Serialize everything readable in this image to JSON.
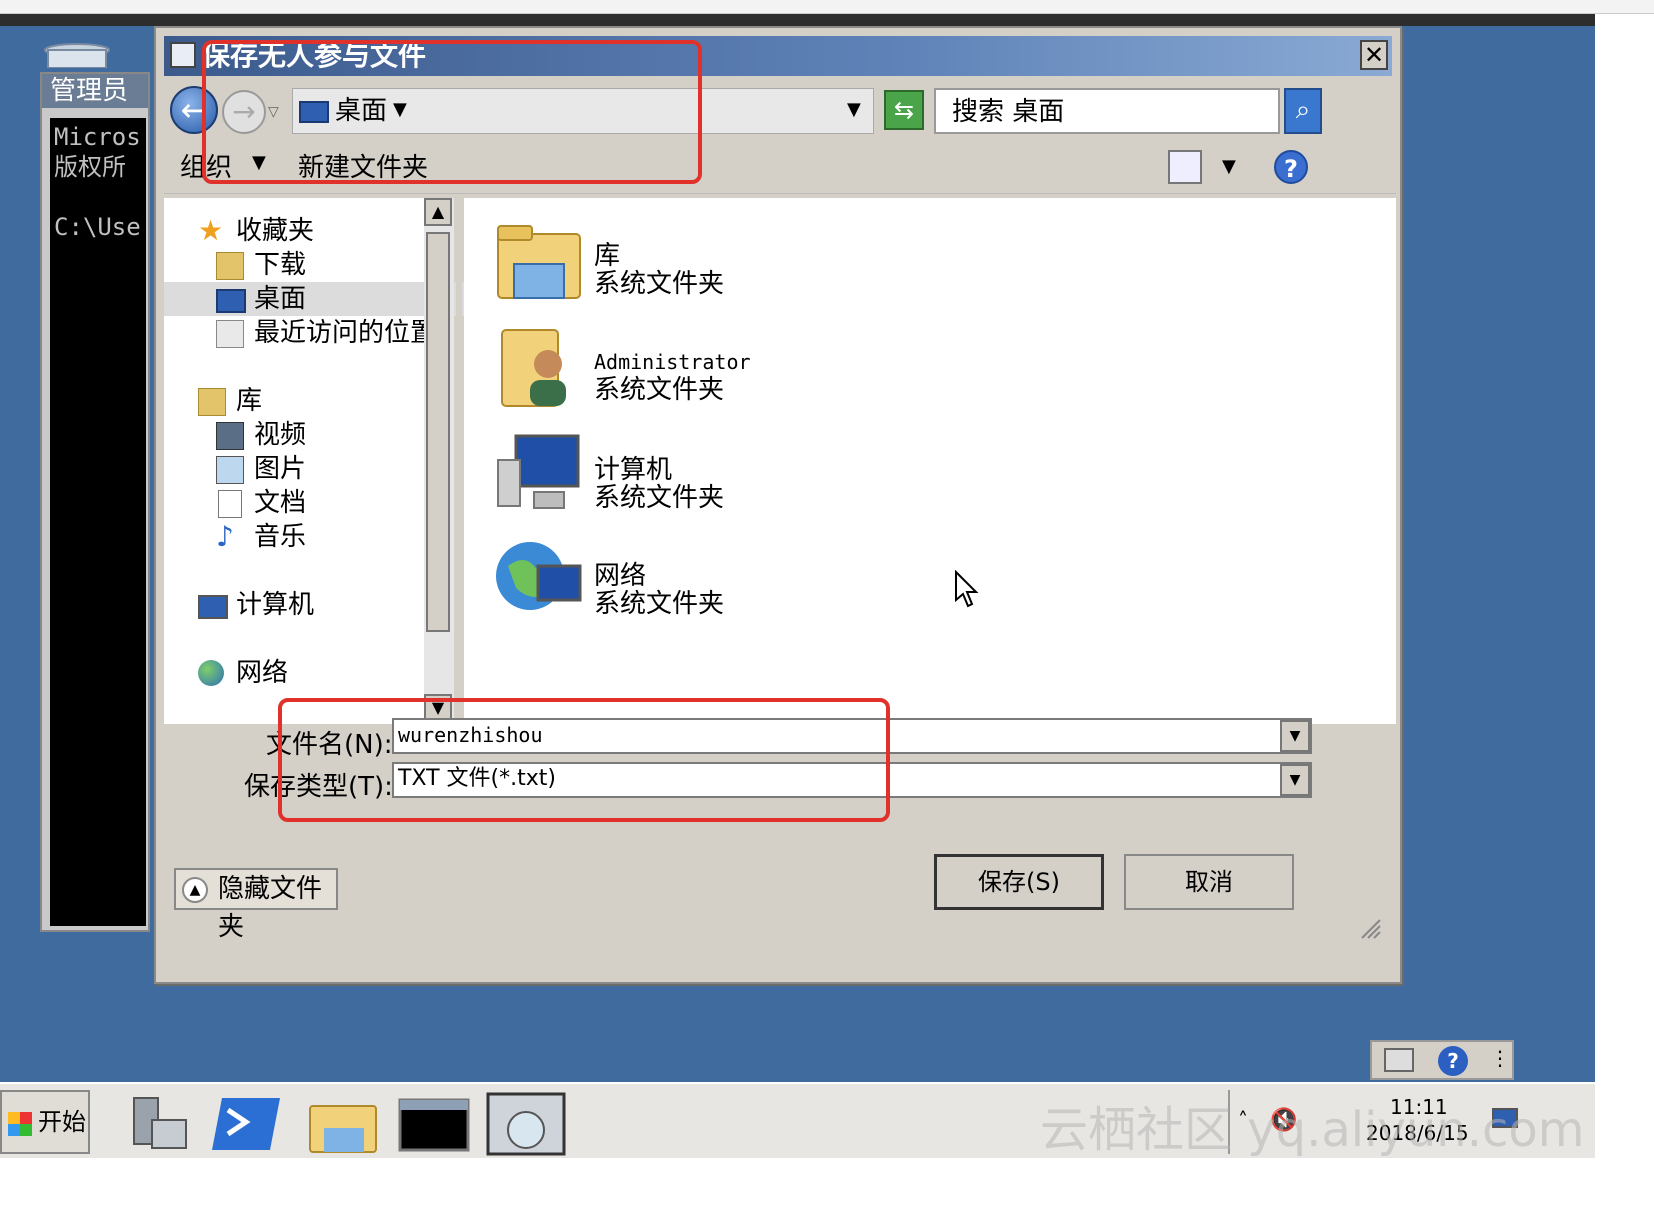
{
  "dialog": {
    "title": "保存无人参与文件",
    "close": "✕"
  },
  "address": {
    "location": "桌面",
    "search_placeholder": "搜索 桌面"
  },
  "toolbar": {
    "organize_label": "组织",
    "new_folder_label": "新建文件夹",
    "help_label": "?"
  },
  "nav": {
    "favorites": "收藏夹",
    "downloads": "下载",
    "desktop": "桌面",
    "recent": "最近访问的位置",
    "libraries": "库",
    "videos": "视频",
    "pictures": "图片",
    "documents": "文档",
    "music": "音乐",
    "computer": "计算机",
    "network": "网络"
  },
  "content": {
    "items": [
      {
        "name": "库",
        "desc": "系统文件夹"
      },
      {
        "name": "Administrator",
        "desc": "系统文件夹"
      },
      {
        "name": "计算机",
        "desc": "系统文件夹"
      },
      {
        "name": "网络",
        "desc": "系统文件夹"
      }
    ]
  },
  "form": {
    "filename_label": "文件名(N):",
    "filename_value": "wurenzhishou",
    "filetype_label": "保存类型(T):",
    "filetype_value": "TXT 文件(*.txt)",
    "hide_folders": "隐藏文件夹",
    "save": "保存(S)",
    "cancel": "取消"
  },
  "console": {
    "title": "管理员",
    "body": "Micros\n版权所\n\nC:\\Use"
  },
  "taskbar": {
    "start": "开始",
    "time": "11:11",
    "date": "2018/6/15"
  },
  "watermark": "云栖社区 yq.aliyun.com",
  "colors": {
    "desktop": "#3f6b9f",
    "annotation": "#e0312b",
    "dialog_face": "#d4d0c8"
  }
}
